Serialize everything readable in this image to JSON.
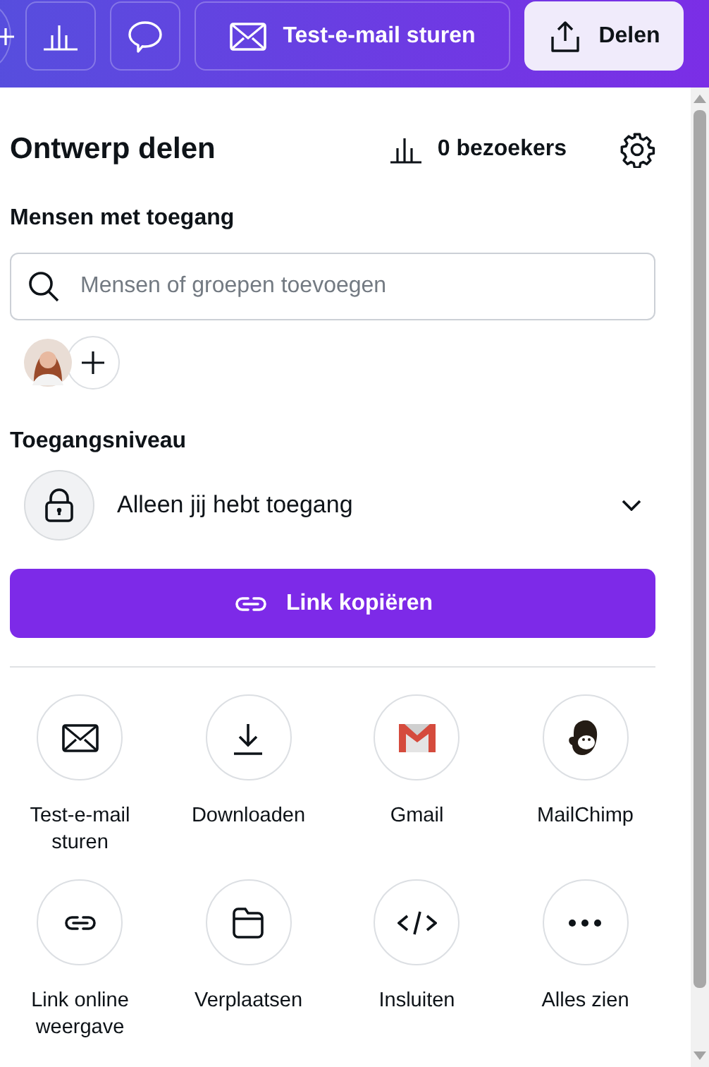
{
  "toolbar": {
    "share_test_button": "Test-e-mail sturen",
    "share_button": "Delen"
  },
  "panel": {
    "title": "Ontwerp delen",
    "visitors": "0 bezoekers",
    "people_heading": "Mensen met toegang",
    "search": {
      "placeholder": "Mensen of groepen toevoegen"
    },
    "access_heading": "Toegangsniveau",
    "access_select": "Alleen jij hebt toegang",
    "copy_link_button": "Link kopiëren",
    "options": [
      {
        "kind": "mail",
        "label": "Test-e-mail sturen"
      },
      {
        "kind": "download",
        "label": "Downloaden"
      },
      {
        "kind": "gmail",
        "label": "Gmail"
      },
      {
        "kind": "mailchimp",
        "label": "MailChimp"
      },
      {
        "kind": "link",
        "label": "Link online weergave"
      },
      {
        "kind": "folder",
        "label": "Verplaatsen"
      },
      {
        "kind": "embed",
        "label": "Insluiten"
      },
      {
        "kind": "more",
        "label": "Alles zien"
      }
    ]
  }
}
